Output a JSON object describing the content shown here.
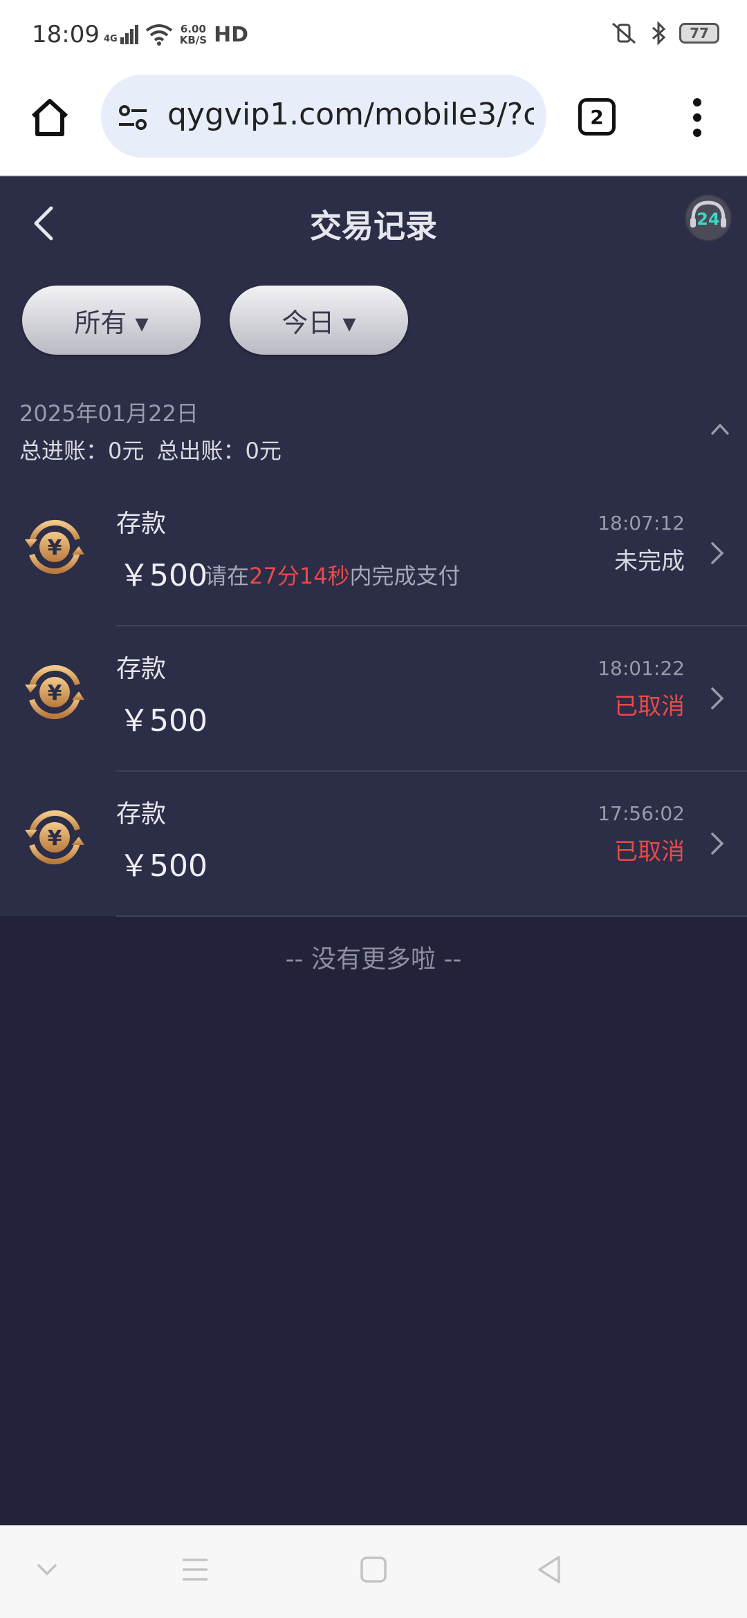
{
  "status_bar": {
    "time": "18:09",
    "network": "4G",
    "speed_value": "6.00",
    "speed_unit": "KB/S",
    "hd": "HD",
    "battery": "77"
  },
  "browser": {
    "url": "qygvip1.com/mobile3/?c",
    "tab_count": "2"
  },
  "header": {
    "title": "交易记录"
  },
  "filters": [
    {
      "label": "所有 ▾"
    },
    {
      "label": "今日 ▾"
    }
  ],
  "summary": {
    "date": "2025年01月22日",
    "income": "总进账：0元",
    "expense": "总出账：0元"
  },
  "records": [
    {
      "type": "存款",
      "amount": "￥500",
      "hint_prefix": "请在",
      "hint_countdown": "27分14秒",
      "hint_suffix": "内完成支付",
      "time": "18:07:12",
      "status": "未完成",
      "status_color": "#d7d8e2"
    },
    {
      "type": "存款",
      "amount": "￥500",
      "time": "18:01:22",
      "status": "已取消",
      "status_color": "#e84a4a"
    },
    {
      "type": "存款",
      "amount": "￥500",
      "time": "17:56:02",
      "status": "已取消",
      "status_color": "#e84a4a"
    }
  ],
  "footer": {
    "no_more": "-- 没有更多啦 --"
  },
  "avatar_badge": "24"
}
